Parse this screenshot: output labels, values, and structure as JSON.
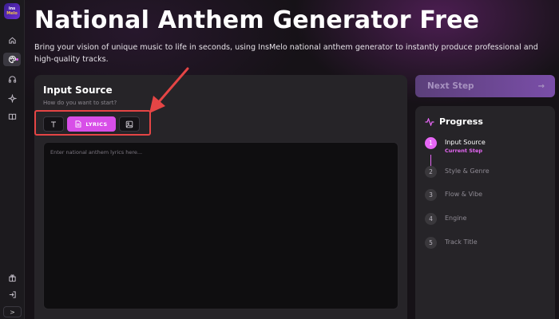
{
  "logo": {
    "line1": "ins",
    "line2": "Melo"
  },
  "sidebar": {
    "icons": [
      "home-icon",
      "palette-icon",
      "headphones-icon",
      "sparkle-icon",
      "book-icon",
      "gift-icon",
      "logout-icon"
    ],
    "collapse_label": ">"
  },
  "header": {
    "title": "National Anthem Generator Free",
    "description": "Bring your vision of unique music to life in seconds, using InsMelo national anthem generator to instantly produce professional and high-quality tracks."
  },
  "input_source": {
    "title": "Input Source",
    "subtitle": "How do you want to start?",
    "buttons": {
      "text_icon": "text-icon",
      "lyrics_label": "LYRICS",
      "image_icon": "image-icon"
    },
    "lyrics_placeholder": "Enter national anthem lyrics here..."
  },
  "next_step": {
    "label": "Next Step",
    "arrow": "→"
  },
  "progress": {
    "title": "Progress",
    "steps": [
      {
        "num": "1",
        "label": "Input Source",
        "status": "Current Step"
      },
      {
        "num": "2",
        "label": "Style & Genre"
      },
      {
        "num": "3",
        "label": "Flow & Vibe"
      },
      {
        "num": "4",
        "label": "Engine"
      },
      {
        "num": "5",
        "label": "Track Title"
      }
    ]
  },
  "colors": {
    "accent": "#d84ee8",
    "highlight": "#e54545",
    "background": "#161217",
    "panel": "#262428"
  }
}
